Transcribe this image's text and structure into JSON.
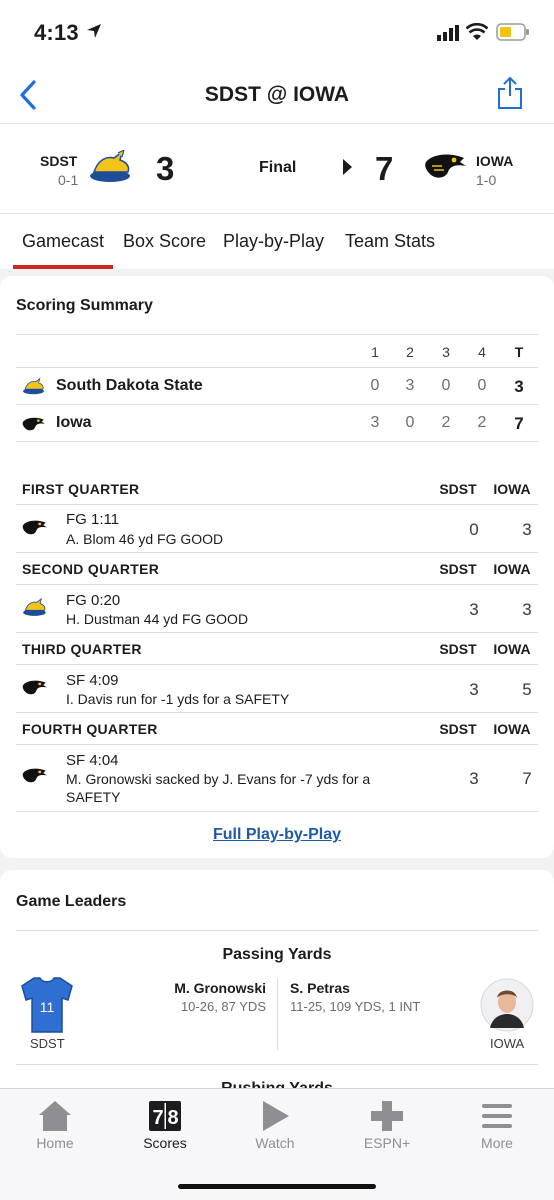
{
  "status_bar": {
    "time": "4:13"
  },
  "nav": {
    "title": "SDST @ IOWA"
  },
  "header": {
    "away": {
      "abbr": "SDST",
      "record": "0-1",
      "score": "3"
    },
    "home": {
      "abbr": "IOWA",
      "record": "1-0",
      "score": "7"
    },
    "status": "Final"
  },
  "tabs": [
    "Gamecast",
    "Box Score",
    "Play-by-Play",
    "Team Stats"
  ],
  "scoring_summary": {
    "title": "Scoring Summary",
    "columns": [
      "1",
      "2",
      "3",
      "4",
      "T"
    ],
    "teams": [
      {
        "name": "South Dakota State",
        "scores": [
          "0",
          "3",
          "0",
          "0",
          "3"
        ]
      },
      {
        "name": "Iowa",
        "scores": [
          "3",
          "0",
          "2",
          "2",
          "7"
        ]
      }
    ],
    "quarters": [
      {
        "name": "FIRST QUARTER",
        "col1": "SDST",
        "col2": "IOWA",
        "play": {
          "type": "FG  1:11",
          "desc": "A. Blom 46 yd FG GOOD",
          "away": "0",
          "home": "3",
          "team": "iowa"
        }
      },
      {
        "name": "SECOND QUARTER",
        "col1": "SDST",
        "col2": "IOWA",
        "play": {
          "type": "FG  0:20",
          "desc": "H. Dustman 44 yd FG GOOD",
          "away": "3",
          "home": "3",
          "team": "sdst"
        }
      },
      {
        "name": "THIRD QUARTER",
        "col1": "SDST",
        "col2": "IOWA",
        "play": {
          "type": "SF  4:09",
          "desc": "I. Davis run for -1 yds for a SAFETY",
          "away": "3",
          "home": "5",
          "team": "iowa"
        }
      },
      {
        "name": "FOURTH QUARTER",
        "col1": "SDST",
        "col2": "IOWA",
        "play": {
          "type": "SF  4:04",
          "desc": "M. Gronowski sacked by J. Evans for -7 yds for a SAFETY",
          "away": "3",
          "home": "7",
          "team": "iowa"
        }
      }
    ],
    "full_pbp_link": "Full Play-by-Play"
  },
  "game_leaders": {
    "title": "Game Leaders",
    "category": "Passing Yards",
    "next_category": "Rushing Yards",
    "away": {
      "name": "M. Gronowski",
      "stat": "10-26, 87 YDS",
      "team": "SDST",
      "jersey": "11"
    },
    "home": {
      "name": "S. Petras",
      "stat": "11-25, 109 YDS, 1 INT",
      "team": "IOWA"
    }
  },
  "tab_bar": [
    "Home",
    "Scores",
    "Watch",
    "ESPN+",
    "More"
  ],
  "colors": {
    "accent": "#d0271d",
    "link": "#1e5aa8",
    "jersey": "#2f6fd1"
  }
}
